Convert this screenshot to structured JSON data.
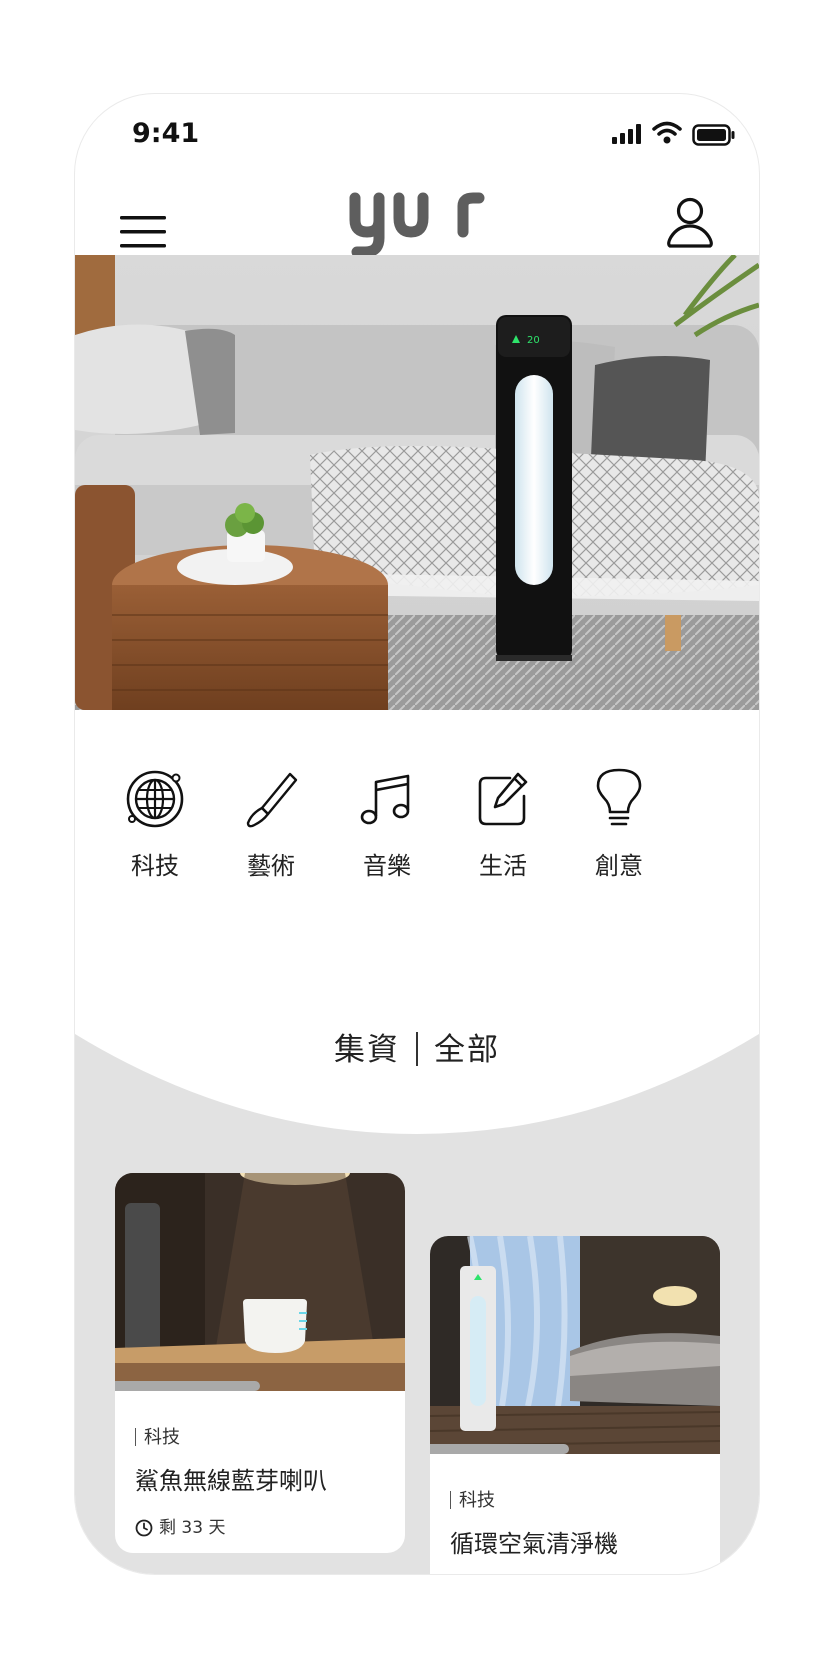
{
  "status_bar": {
    "time": "9:41"
  },
  "header": {
    "logo_text": "yu r"
  },
  "categories": [
    {
      "label": "科技",
      "icon": "globe-icon"
    },
    {
      "label": "藝術",
      "icon": "brush-icon"
    },
    {
      "label": "音樂",
      "icon": "music-note-icon"
    },
    {
      "label": "生活",
      "icon": "edit-icon"
    },
    {
      "label": "創意",
      "icon": "lightbulb-icon"
    }
  ],
  "section": {
    "left": "集資",
    "right": "全部"
  },
  "products": [
    {
      "tag": "科技",
      "title": "鯊魚無線藍芽喇叭",
      "remaining": "剩 33 天",
      "progress": 0.5
    },
    {
      "tag": "科技",
      "title": "循環空氣清淨機",
      "progress": 0.5
    }
  ],
  "colors": {
    "accent_green": "#2ee36b",
    "section_bg": "#e2e2e2"
  }
}
